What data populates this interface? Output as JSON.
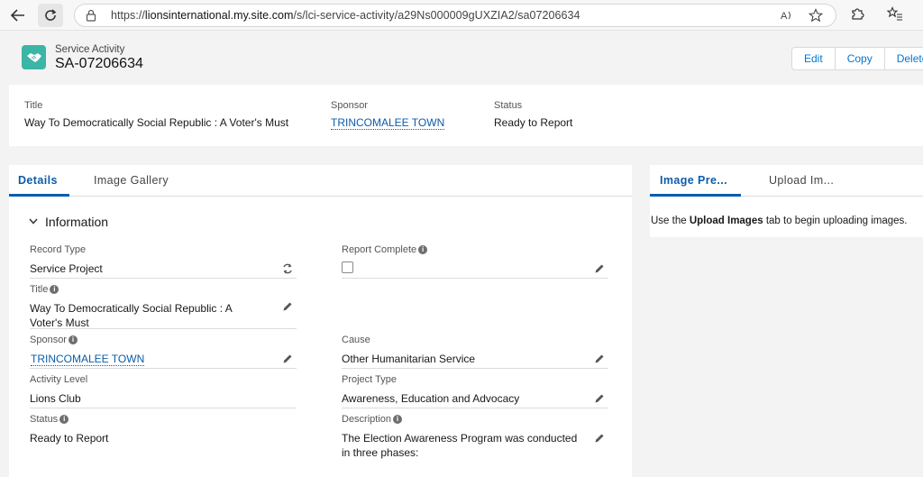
{
  "browser": {
    "url_prefix": "https://",
    "url_host": "lionsinternational.my.site.com",
    "url_path": "/s/lci-service-activity/a29Ns000009gUXZIA2/sa07206634"
  },
  "record": {
    "kind": "Service Activity",
    "name": "SA-07206634",
    "actions": {
      "edit": "Edit",
      "copy": "Copy",
      "delete": "Delete"
    }
  },
  "highlights": {
    "title_label": "Title",
    "title_value": "Way To Democratically Social Republic : A Voter's Must",
    "sponsor_label": "Sponsor",
    "sponsor_value": "TRINCOMALEE TOWN",
    "status_label": "Status",
    "status_value": "Ready to Report"
  },
  "left_tabs": {
    "details": "Details",
    "gallery": "Image Gallery"
  },
  "section": {
    "title": "Information"
  },
  "fields": {
    "record_type_label": "Record Type",
    "record_type_value": "Service Project",
    "report_complete_label": "Report Complete",
    "title_label": "Title",
    "title_value": "Way To Democratically Social Republic : A Voter's Must",
    "sponsor_label": "Sponsor",
    "sponsor_value": "TRINCOMALEE TOWN",
    "cause_label": "Cause",
    "cause_value": "Other Humanitarian Service",
    "activity_level_label": "Activity Level",
    "activity_level_value": "Lions Club",
    "project_type_label": "Project Type",
    "project_type_value": "Awareness, Education and Advocacy",
    "status_label": "Status",
    "status_value": "Ready to Report",
    "description_label": "Description",
    "description_value": "The Election Awareness Program was conducted in three phases:"
  },
  "right_tabs": {
    "preview": "Image Pre...",
    "upload": "Upload Im..."
  },
  "right_message": {
    "before": "Use the ",
    "bold": "Upload Images",
    "after": " tab to begin uploading images."
  },
  "icons": {
    "back": "back-arrow-icon",
    "reload": "reload-icon",
    "lock": "lock-icon",
    "read_aloud": "read-aloud-icon",
    "favorite": "star-icon",
    "extensions": "extensions-icon",
    "favorites_bar": "favorites-icon",
    "record": "handshake-icon",
    "chevron": "chevron-down-icon",
    "info": "info-icon",
    "pencil": "pencil-icon",
    "change_type": "change-record-type-icon"
  },
  "colors": {
    "accent": "#0b5cab",
    "record_icon": "#3bb5a5"
  }
}
